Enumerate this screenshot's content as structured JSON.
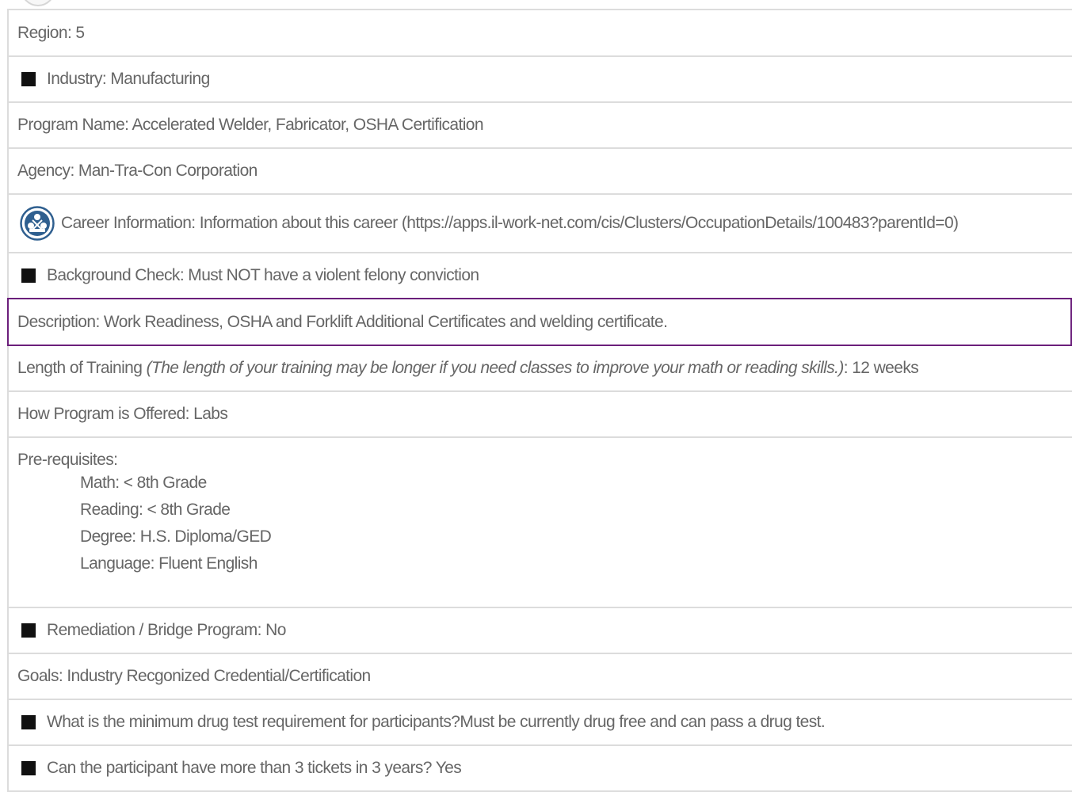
{
  "program": {
    "region": "Region: 5",
    "industry": "Industry: Manufacturing",
    "program_name": "Program Name: Accelerated Welder, Fabricator, OSHA Certification",
    "agency": "Agency: Man-Tra-Con Corporation",
    "career_info": "Career Information: Information about this career (https://apps.il-work-net.com/cis/Clusters/OccupationDetails/100483?parentId=0)",
    "background_check": "Background Check: Must NOT have a violent felony conviction",
    "description": "Description: Work Readiness, OSHA and Forklift Additional Certificates and welding certificate.",
    "length_label": "Length of Training ",
    "length_note": "(The length of your training may be longer if you need classes to improve your math or reading skills.)",
    "length_value": ": 12 weeks",
    "how_offered": "How Program is Offered: Labs",
    "prereq_title": "Pre-requisites:",
    "prereq_math": "Math: < 8th Grade",
    "prereq_reading": "Reading: < 8th Grade",
    "prereq_degree": "Degree: H.S. Diploma/GED",
    "prereq_language": "Language: Fluent English",
    "remediation": "Remediation / Bridge Program: No",
    "goals": "Goals: Industry Recgonized Credential/Certification",
    "drug_test": "What is the minimum drug test requirement for participants?Must be currently drug free and can pass a drug test.",
    "tickets": "Can the participant have more than 3 tickets in 3 years? Yes"
  },
  "colors": {
    "text": "#666666",
    "border": "#dcdcdc",
    "highlight_border": "#6b1f7b",
    "bullet": "#111111",
    "icon_blue": "#2f5f8f"
  },
  "icons": {
    "bullet": "square-bullet-icon",
    "career": "career-cluster-icon"
  }
}
